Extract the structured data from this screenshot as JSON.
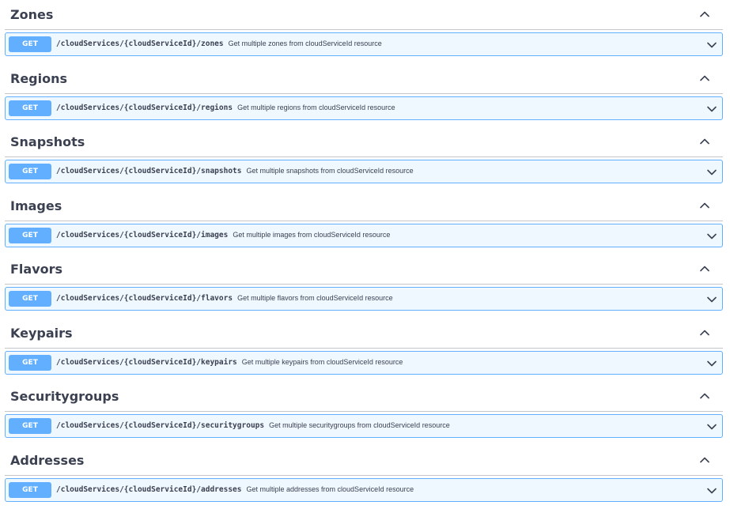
{
  "sections": [
    {
      "id": "zones",
      "title": "Zones",
      "method": "GET",
      "path": "/cloudServices/{cloudServiceId}/zones",
      "summary": "Get multiple zones from cloudServiceId resource"
    },
    {
      "id": "regions",
      "title": "Regions",
      "method": "GET",
      "path": "/cloudServices/{cloudServiceId}/regions",
      "summary": "Get multiple regions from cloudServiceId resource"
    },
    {
      "id": "snapshots",
      "title": "Snapshots",
      "method": "GET",
      "path": "/cloudServices/{cloudServiceId}/snapshots",
      "summary": "Get multiple snapshots from cloudServiceId resource"
    },
    {
      "id": "images",
      "title": "Images",
      "method": "GET",
      "path": "/cloudServices/{cloudServiceId}/images",
      "summary": "Get multiple images from cloudServiceId resource"
    },
    {
      "id": "flavors",
      "title": "Flavors",
      "method": "GET",
      "path": "/cloudServices/{cloudServiceId}/flavors",
      "summary": "Get multiple flavors from cloudServiceId resource"
    },
    {
      "id": "keypairs",
      "title": "Keypairs",
      "method": "GET",
      "path": "/cloudServices/{cloudServiceId}/keypairs",
      "summary": "Get multiple keypairs from cloudServiceId resource"
    },
    {
      "id": "securitygroups",
      "title": "Securitygroups",
      "method": "GET",
      "path": "/cloudServices/{cloudServiceId}/securitygroups",
      "summary": "Get multiple securitygroups from cloudServiceId resource"
    },
    {
      "id": "addresses",
      "title": "Addresses",
      "method": "GET",
      "path": "/cloudServices/{cloudServiceId}/addresses",
      "summary": "Get multiple addresses from cloudServiceId resource"
    }
  ],
  "icons": {
    "section_toggle": "chevron-up-icon",
    "operation_toggle": "chevron-down-icon"
  },
  "colors": {
    "get_method": "#61affe",
    "get_block_background": "rgba(97,175,254,0.1)",
    "text": "#3b4151"
  }
}
